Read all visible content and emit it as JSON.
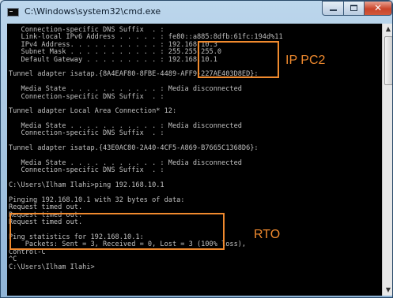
{
  "window": {
    "title": "C:\\Windows\\system32\\cmd.exe",
    "close_glyph": "✕"
  },
  "console": {
    "lines": [
      "   Connection-specific DNS Suffix  . :",
      "   Link-local IPv6 Address . . . . . : fe80::a885:8dfb:61fc:194d%11",
      "   IPv4 Address. . . . . . . . . . . : 192.168.10.3",
      "   Subnet Mask . . . . . . . . . . . : 255.255.255.0",
      "   Default Gateway . . . . . . . . . : 192.168.10.1",
      "",
      "Tunnel adapter isatap.{8A4EAF80-8FBE-4489-AFF9-227AE403D8ED}:",
      "",
      "   Media State . . . . . . . . . . . : Media disconnected",
      "   Connection-specific DNS Suffix  . :",
      "",
      "Tunnel adapter Local Area Connection* 12:",
      "",
      "   Media State . . . . . . . . . . . : Media disconnected",
      "   Connection-specific DNS Suffix  . :",
      "",
      "Tunnel adapter isatap.{43E0AC80-2A40-4CF5-A869-B7665C1368D6}:",
      "",
      "   Media State . . . . . . . . . . . : Media disconnected",
      "   Connection-specific DNS Suffix  . :",
      "",
      "C:\\Users\\Ilham Ilahi>ping 192.168.10.1",
      "",
      "Pinging 192.168.10.1 with 32 bytes of data:",
      "Request timed out.",
      "Request timed out.",
      "Request timed out.",
      "",
      "Ping statistics for 192.168.10.1:",
      "    Packets: Sent = 3, Received = 0, Lost = 3 (100% loss),",
      "Control-C",
      "^C",
      "C:\\Users\\Ilham Ilahi>"
    ]
  },
  "annotations": {
    "ip_label": "IP PC2",
    "rto_label": "RTO",
    "color": "#f08a2e"
  }
}
